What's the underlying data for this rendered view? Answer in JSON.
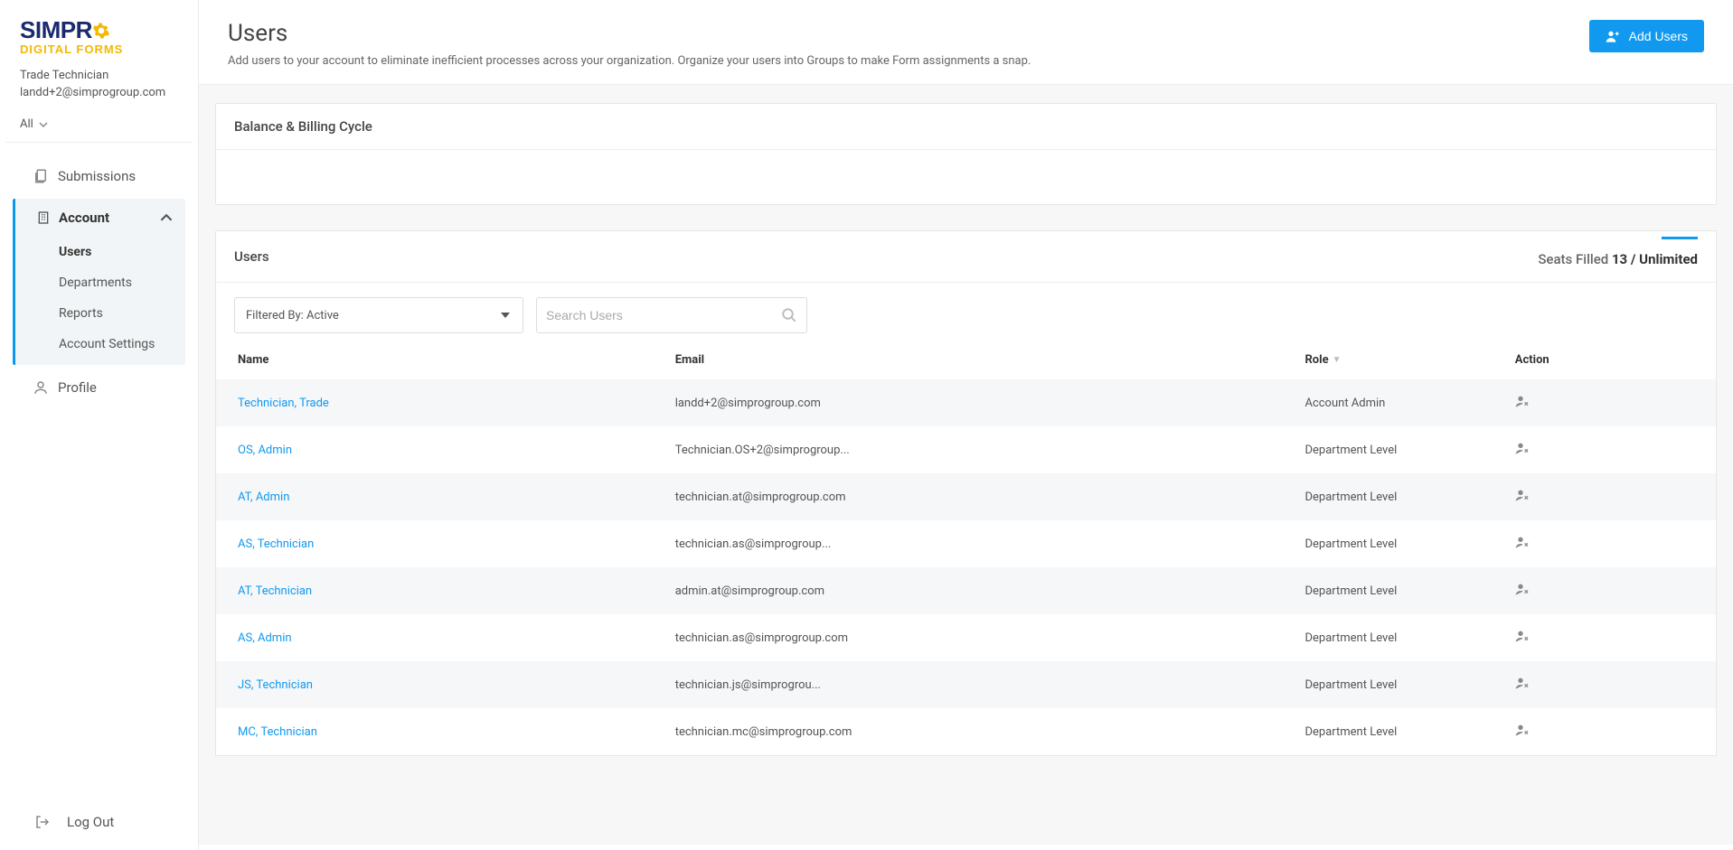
{
  "logo": {
    "text1": "SIMPR",
    "text2": "DIGITAL FORMS"
  },
  "current_user": {
    "name": "Trade Technician",
    "email": "landd+2@simprogroup.com"
  },
  "scope_selector": {
    "label": "All"
  },
  "sidebar": {
    "submissions": "Submissions",
    "account": "Account",
    "account_children": {
      "users": "Users",
      "departments": "Departments",
      "reports": "Reports",
      "account_settings": "Account Settings"
    },
    "profile": "Profile",
    "logout": "Log Out"
  },
  "page": {
    "title": "Users",
    "subtitle": "Add users to your account to eliminate inefficient processes across your organization. Organize your users into Groups to make Form assignments a snap.",
    "add_button": "Add Users"
  },
  "billing_panel": {
    "title": "Balance & Billing Cycle"
  },
  "users_panel": {
    "title": "Users",
    "seats_label": "Seats Filled ",
    "seats_count": "13",
    "seats_total": " / Unlimited",
    "filter_label": "Filtered By: Active",
    "search_placeholder": "Search Users",
    "columns": {
      "name": "Name",
      "email": "Email",
      "role": "Role",
      "action": "Action"
    },
    "rows": [
      {
        "name": "Technician, Trade",
        "email": "landd+2@simprogroup.com",
        "role": "Account Admin"
      },
      {
        "name": "OS, Admin",
        "email": "Technician.OS+2@simprogroup...",
        "role": "Department Level"
      },
      {
        "name": "AT, Admin",
        "email": "technician.at@simprogroup.com",
        "role": "Department Level"
      },
      {
        "name": "AS, Technician",
        "email": "technician.as@simprogroup...",
        "role": "Department Level"
      },
      {
        "name": "AT, Technician",
        "email": "admin.at@simprogroup.com",
        "role": "Department Level"
      },
      {
        "name": "AS, Admin",
        "email": "technician.as@simprogroup.com",
        "role": "Department Level"
      },
      {
        "name": "JS, Technician",
        "email": "technician.js@simprogrou...",
        "role": "Department Level"
      },
      {
        "name": "MC, Technician",
        "email": "technician.mc@simprogroup.com",
        "role": "Department Level"
      }
    ]
  }
}
